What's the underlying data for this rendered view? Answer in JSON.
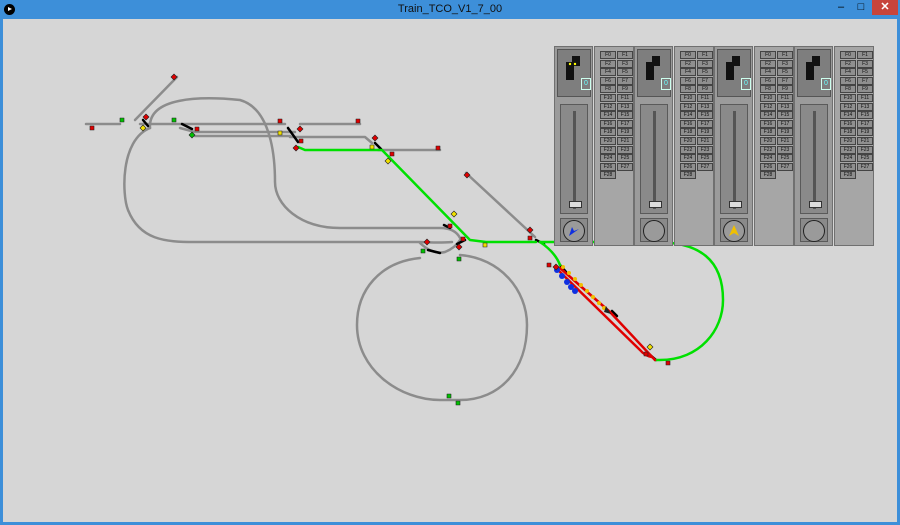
{
  "window": {
    "title": "Train_TCO_V1_7_00",
    "minimize_glyph": "–",
    "maximize_glyph": "□",
    "close_glyph": "✕"
  },
  "colors": {
    "track": "#8c8c8c",
    "route_active": "#00e000",
    "route_blocked": "#e00000",
    "train_blue": "#1030e0",
    "train_yellow": "#f0c000",
    "signal_red": "#e00000",
    "signal_green": "#00c000",
    "signal_yellow": "#f0e000"
  },
  "cabs": [
    {
      "id": 1,
      "direction_icon": "arrow-down-left",
      "arrow_color": "#1030e0",
      "dir_label": "0"
    },
    {
      "id": 2,
      "direction_icon": "none",
      "arrow_color": "",
      "dir_label": "0"
    },
    {
      "id": 3,
      "direction_icon": "arrow-up",
      "arrow_color": "#f0c000",
      "dir_label": "0"
    },
    {
      "id": 4,
      "direction_icon": "none",
      "arrow_color": "",
      "dir_label": "0"
    }
  ],
  "function_keys": [
    "F0",
    "F1",
    "F2",
    "F3",
    "F4",
    "F5",
    "F6",
    "F7",
    "F8",
    "F9",
    "F10",
    "F11",
    "F12",
    "F13",
    "F14",
    "F15",
    "F16",
    "F17",
    "F18",
    "F19",
    "F20",
    "F21",
    "F22",
    "F23",
    "F24",
    "F25",
    "F26",
    "F27",
    "F28"
  ]
}
